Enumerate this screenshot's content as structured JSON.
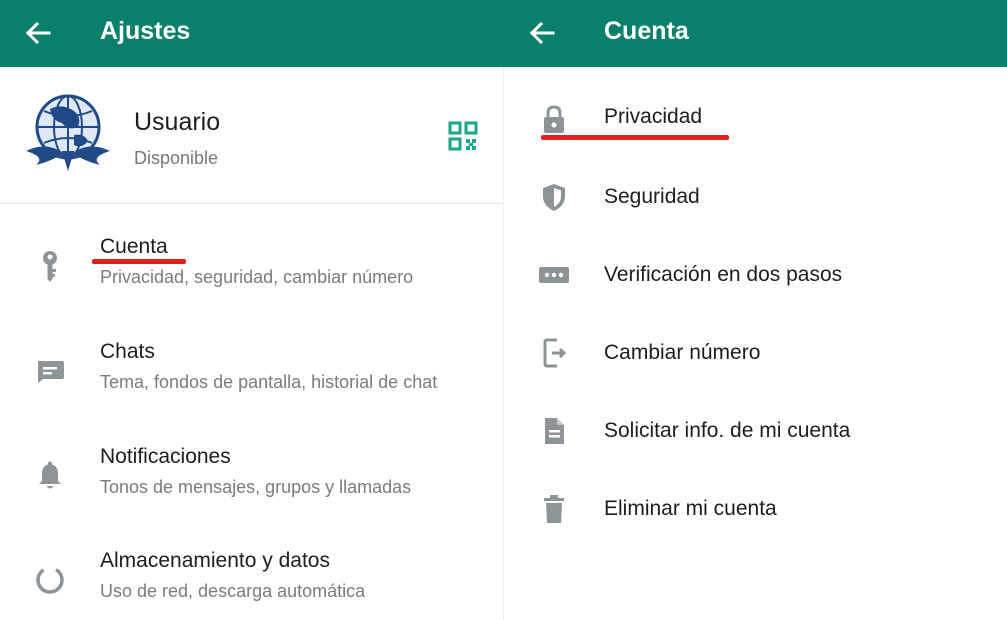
{
  "colors": {
    "toolbar": "#0a806a",
    "accent": "#1aa68a",
    "icon_gray": "#8c9498",
    "annotation_red": "#e0211f"
  },
  "left_panel": {
    "title": "Ajustes",
    "back_icon": "arrow-left-icon",
    "profile": {
      "name": "Usuario",
      "status": "Disponible",
      "avatar_icon": "globe-eagle-logo",
      "qr_icon": "qr-code-icon"
    },
    "settings": [
      {
        "label": "Cuenta",
        "subtitle": "Privacidad, seguridad, cambiar número",
        "icon": "key-icon",
        "highlighted": true
      },
      {
        "label": "Chats",
        "subtitle": "Tema, fondos de pantalla, historial de chat",
        "icon": "chat-icon",
        "highlighted": false
      },
      {
        "label": "Notificaciones",
        "subtitle": "Tonos de mensajes, grupos y llamadas",
        "icon": "bell-icon",
        "highlighted": false
      },
      {
        "label": "Almacenamiento y datos",
        "subtitle": "Uso de red, descarga automática",
        "icon": "storage-circle-icon",
        "highlighted": false
      }
    ]
  },
  "right_panel": {
    "title": "Cuenta",
    "back_icon": "arrow-left-icon",
    "items": [
      {
        "label": "Privacidad",
        "icon": "lock-icon",
        "highlighted": true
      },
      {
        "label": "Seguridad",
        "icon": "shield-icon",
        "highlighted": false
      },
      {
        "label": "Verificación en dos pasos",
        "icon": "password-dots-icon",
        "highlighted": false
      },
      {
        "label": "Cambiar número",
        "icon": "phone-change-icon",
        "highlighted": false
      },
      {
        "label": "Solicitar info. de mi cuenta",
        "icon": "document-icon",
        "highlighted": false
      },
      {
        "label": "Eliminar mi cuenta",
        "icon": "trash-icon",
        "highlighted": false
      }
    ]
  }
}
